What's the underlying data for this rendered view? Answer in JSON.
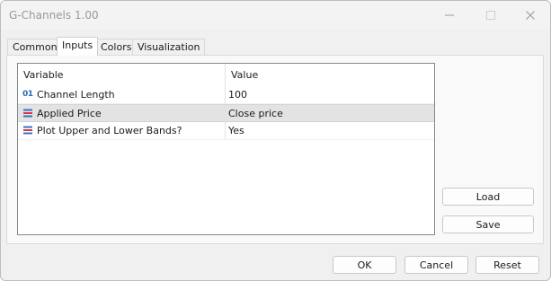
{
  "window": {
    "title": "G-Channels 1.00"
  },
  "tabs": [
    {
      "label": "Common",
      "active": false
    },
    {
      "label": "Inputs",
      "active": true
    },
    {
      "label": "Colors",
      "active": false
    },
    {
      "label": "Visualization",
      "active": false
    }
  ],
  "grid": {
    "columns": [
      "Variable",
      "Value"
    ],
    "rows": [
      {
        "icon": "integer-icon",
        "icon_text": "01",
        "variable": "Channel Length",
        "value": "100",
        "selected": false
      },
      {
        "icon": "enum-list-icon",
        "variable": "Applied Price",
        "value": "Close price",
        "selected": true
      },
      {
        "icon": "enum-list-icon",
        "variable": "Plot Upper and Lower Bands?",
        "value": "Yes",
        "selected": false
      }
    ]
  },
  "side_buttons": {
    "load_label": "Load",
    "save_label": "Save"
  },
  "footer": {
    "ok_label": "OK",
    "cancel_label": "Cancel",
    "reset_label": "Reset"
  },
  "colors": {
    "integer_icon": "#2b6cb0",
    "enum_icon_blue": "#3b6fc4",
    "enum_icon_red": "#d23b3b",
    "selected_row": "#e3e3e3"
  }
}
